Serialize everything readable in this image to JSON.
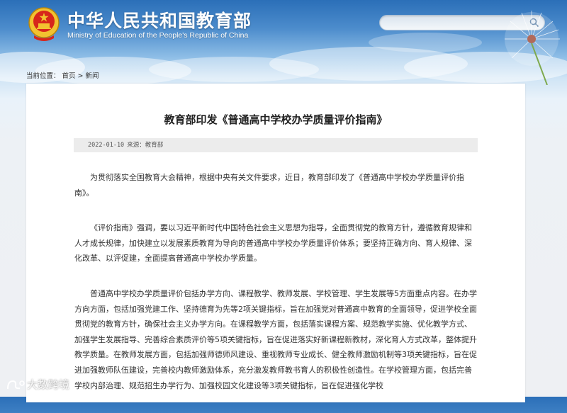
{
  "header": {
    "title_cn": "中华人民共和国教育部",
    "title_en": "Ministry of Education of the People's Republic of China",
    "search": {
      "value": "",
      "icon": "search-icon"
    }
  },
  "breadcrumb": {
    "prefix": "当前位置：",
    "items": [
      "首页",
      "新闻"
    ],
    "separator": ">"
  },
  "article": {
    "title": "教育部印发《普通高中学校办学质量评价指南》",
    "date": "2022-01-10",
    "source": "来源：教育部",
    "paragraphs": [
      "为贯彻落实全国教育大会精神，根据中央有关文件要求，近日，教育部印发了《普通高中学校办学质量评价指南》。",
      "《评价指南》强调，要以习近平新时代中国特色社会主义思想为指导，全面贯彻党的教育方针，遵循教育规律和人才成长规律，加快建立以发展素质教育为导向的普通高中学校办学质量评价体系；要坚持正确方向、育人规律、深化改革、以评促建，全面提高普通高中学校办学质量。",
      "普通高中学校办学质量评价包括办学方向、课程教学、教师发展、学校管理、学生发展等5方面重点内容。在办学方向方面，包括加强党建工作、坚持德育为先等2项关键指标，旨在加强党对普通高中教育的全面领导，促进学校全面贯彻党的教育方针，确保社会主义办学方向。在课程教学方面，包括落实课程方案、规范教学实施、优化教学方式、加强学生发展指导、完善综合素质评价等5项关键指标，旨在促进落实好新课程新教材，深化育人方式改革，整体提升教学质量。在教师发展方面，包括加强师德师风建设、重视教师专业成长、健全教师激励机制等3项关键指标，旨在促进加强教师队伍建设，完善校内教师激励体系，充分激发教师教书育人的积极性创造性。在学校管理方面，包括完善学校内部治理、规范招生办学行为、加强校园文化建设等3项关键指标，旨在促进强化学校"
    ]
  },
  "watermark": {
    "text": "大数跨境"
  },
  "colors": {
    "header_blue": "#2b6fb8",
    "panel": "#ffffff",
    "meta_bg": "#ececec",
    "text": "#333333"
  }
}
